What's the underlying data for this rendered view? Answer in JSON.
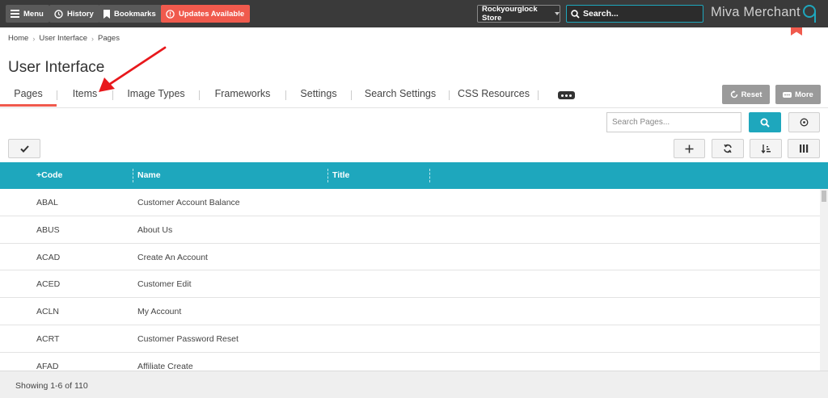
{
  "topbar": {
    "menu_label": "Menu",
    "history_label": "History",
    "bookmarks_label": "Bookmarks",
    "updates_label": "Updates Available",
    "store_name": "Rockyourglock Store",
    "search_placeholder": "Search...",
    "logo_text": "Miva Merchant"
  },
  "breadcrumb": [
    "Home",
    "User Interface",
    "Pages"
  ],
  "page_title": "User Interface",
  "tabs": [
    {
      "label": "Pages",
      "active": true
    },
    {
      "label": "Items",
      "active": false
    },
    {
      "label": "Image Types",
      "active": false
    },
    {
      "label": "Frameworks",
      "active": false
    },
    {
      "label": "Settings",
      "active": false
    },
    {
      "label": "Search Settings",
      "active": false
    },
    {
      "label": "CSS Resources",
      "active": false
    }
  ],
  "actions": {
    "reset_label": "Reset",
    "more_label": "More"
  },
  "toolbar": {
    "search_placeholder": "Search Pages..."
  },
  "grid": {
    "columns": [
      "+Code",
      "Name",
      "Title"
    ],
    "rows": [
      {
        "code": "ABAL",
        "name": "Customer Account Balance",
        "title": ""
      },
      {
        "code": "ABUS",
        "name": "About Us",
        "title": ""
      },
      {
        "code": "ACAD",
        "name": "Create An Account",
        "title": ""
      },
      {
        "code": "ACED",
        "name": "Customer Edit",
        "title": ""
      },
      {
        "code": "ACLN",
        "name": "My Account",
        "title": ""
      },
      {
        "code": "ACRT",
        "name": "Customer Password Reset",
        "title": ""
      },
      {
        "code": "AFAD",
        "name": "Affiliate Create",
        "title": ""
      }
    ]
  },
  "footer": {
    "showing": "Showing 1-6 of 110"
  },
  "colors": {
    "accent": "#1ea7bd",
    "brand_red": "#f05a4d",
    "topbar": "#3a3a3a"
  }
}
